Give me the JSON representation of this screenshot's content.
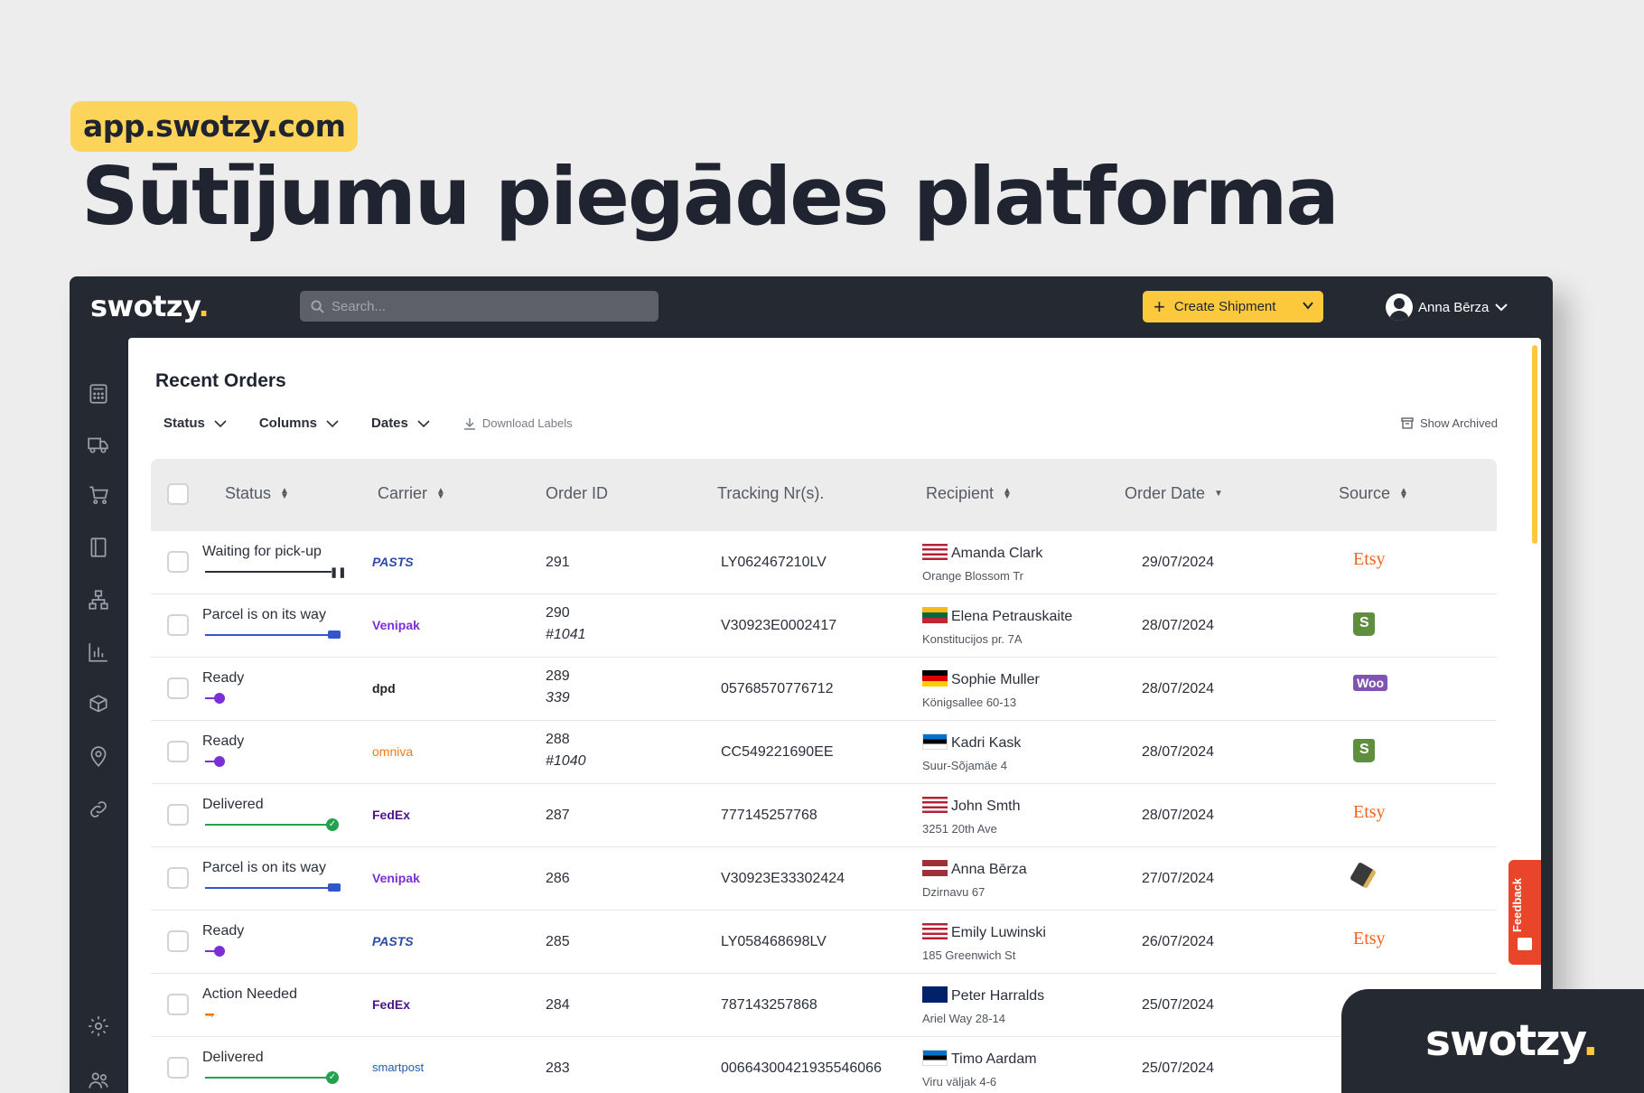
{
  "hero": {
    "url": "app.swotzy.com",
    "title": "Sūtījumu piegādes platforma"
  },
  "app": {
    "logo_text": "swotzy",
    "logo_dot": ".",
    "search_placeholder": "Search...",
    "create_button": "Create Shipment",
    "user_name": "Anna Bērza",
    "accent_color": "#fcc93c",
    "dark_color": "#242932"
  },
  "sidebar": {
    "icons": [
      "calculator-icon",
      "truck-icon",
      "cart-icon",
      "book-icon",
      "org-chart-icon",
      "bar-chart-icon",
      "package-settings-icon",
      "location-icon",
      "link-icon",
      "settings-icon",
      "users-icon"
    ]
  },
  "panel": {
    "title": "Recent Orders",
    "filters": [
      "Status",
      "Columns",
      "Dates"
    ],
    "download_labels": "Download Labels",
    "show_archived": "Show Archived",
    "feedback": "Feedback"
  },
  "table": {
    "columns": [
      "Status",
      "Carrier",
      "Order ID",
      "Tracking Nr(s).",
      "Recipient",
      "Order Date",
      "Source"
    ],
    "rows": [
      {
        "status": "Waiting for pick-up",
        "status_kind": "waiting",
        "carrier": "PASTS",
        "order_id": "291",
        "order_ref": "",
        "tracking": "LY062467210LV",
        "flag": "us",
        "name": "Amanda Clark",
        "address": "Orange Blossom Tr",
        "date": "29/07/2024",
        "source": "Etsy"
      },
      {
        "status": "Parcel is on its way",
        "status_kind": "transit",
        "carrier": "Venipak",
        "order_id": "290",
        "order_ref": "#1041",
        "tracking": "V30923E0002417",
        "flag": "lt",
        "name": "Elena Petrauskaite",
        "address": "Konstitucijos pr. 7A",
        "date": "28/07/2024",
        "source": "shopify"
      },
      {
        "status": "Ready",
        "status_kind": "ready",
        "carrier": "dpd",
        "order_id": "289",
        "order_ref": "339",
        "tracking": "05768570776712",
        "flag": "de",
        "name": "Sophie Muller",
        "address": "Königsallee 60-13",
        "date": "28/07/2024",
        "source": "Woo"
      },
      {
        "status": "Ready",
        "status_kind": "ready",
        "carrier": "omniva",
        "order_id": "288",
        "order_ref": "#1040",
        "tracking": "CC549221690EE",
        "flag": "ee",
        "name": "Kadri Kask",
        "address": "Suur-Sõjamäe 4",
        "date": "28/07/2024",
        "source": "shopify"
      },
      {
        "status": "Delivered",
        "status_kind": "delivered",
        "carrier": "FedEx",
        "order_id": "287",
        "order_ref": "",
        "tracking": "777145257768",
        "flag": "us",
        "name": "John Smth",
        "address": "3251 20th Ave",
        "date": "28/07/2024",
        "source": "Etsy"
      },
      {
        "status": "Parcel is on its way",
        "status_kind": "transit",
        "carrier": "Venipak",
        "order_id": "286",
        "order_ref": "",
        "tracking": "V30923E33302424",
        "flag": "lv",
        "name": "Anna Bērza",
        "address": "Dzirnavu 67",
        "date": "27/07/2024",
        "source": "box"
      },
      {
        "status": "Ready",
        "status_kind": "ready",
        "carrier": "PASTS",
        "order_id": "285",
        "order_ref": "",
        "tracking": "LY058468698LV",
        "flag": "us",
        "name": "Emily Luwinski",
        "address": "185 Greenwich St",
        "date": "26/07/2024",
        "source": "Etsy"
      },
      {
        "status": "Action Needed",
        "status_kind": "action",
        "carrier": "FedEx",
        "order_id": "284",
        "order_ref": "",
        "tracking": "787143257868",
        "flag": "gb",
        "name": "Peter Harralds",
        "address": "Ariel Way 28-14",
        "date": "25/07/2024",
        "source": ""
      },
      {
        "status": "Delivered",
        "status_kind": "delivered",
        "carrier": "smartpost",
        "order_id": "283",
        "order_ref": "",
        "tracking": "00664300421935546066",
        "flag": "ee",
        "name": "Timo Aardam",
        "address": "Viru väljak 4-6",
        "date": "25/07/2024",
        "source": ""
      }
    ]
  },
  "corner_badge": {
    "logo_text": "swotzy",
    "logo_dot": "."
  }
}
